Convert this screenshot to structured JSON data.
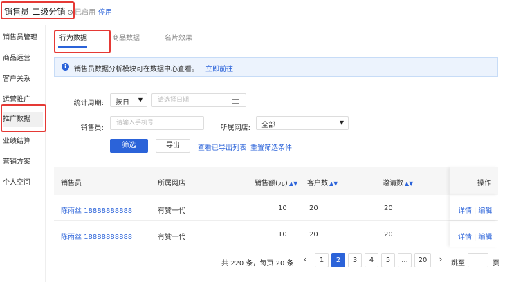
{
  "header": {
    "title": "销售员-二级分销",
    "title_icon": "⊙",
    "status": "已启用",
    "disable_label": "停用"
  },
  "sidebar": {
    "items": [
      {
        "label": "销售员管理"
      },
      {
        "label": "商品运营"
      },
      {
        "label": "客户关系"
      },
      {
        "label": "运营推广"
      },
      {
        "label": "推广数据"
      },
      {
        "label": "业绩结算"
      },
      {
        "label": "营销方案"
      },
      {
        "label": "个人空间"
      }
    ]
  },
  "tabs": [
    {
      "label": "行为数据"
    },
    {
      "label": "商品数据"
    },
    {
      "label": "名片效果"
    }
  ],
  "notice": {
    "text": "销售员数据分析模块可在数据中心查看。",
    "link": "立即前往"
  },
  "filters": {
    "period_label": "统计周期:",
    "period_value": "按日",
    "date_placeholder": "请选择日期",
    "seller_label": "销售员:",
    "seller_placeholder": "请输入手机号",
    "store_label": "所属网店:",
    "store_value": "全部",
    "filter_button": "筛选",
    "export_button": "导出",
    "view_exported": "查看已导出列表",
    "reset": "重置筛选条件"
  },
  "table": {
    "columns": [
      "销售员",
      "所属网店",
      "销售额(元)",
      "客户数",
      "邀请数",
      "操作"
    ],
    "rows": [
      {
        "seller": "陈雨丝 18888888888",
        "store": "有赞一代",
        "sales": "10",
        "customers": "20",
        "invites": "20",
        "detail": "详情",
        "edit": "编辑"
      },
      {
        "seller": "陈雨丝 18888888888",
        "store": "有赞一代",
        "sales": "10",
        "customers": "20",
        "invites": "20",
        "detail": "详情",
        "edit": "编辑"
      }
    ]
  },
  "pagination": {
    "summary": "共 220 条，每页 20 条",
    "prev": "‹",
    "pages": [
      "1",
      "2",
      "3",
      "4",
      "5",
      "...",
      "20"
    ],
    "current": "2",
    "next": "›",
    "jump_label": "跳至",
    "page_suffix": "页"
  },
  "colors": {
    "accent": "#2b63d9",
    "highlight": "#e53935"
  }
}
